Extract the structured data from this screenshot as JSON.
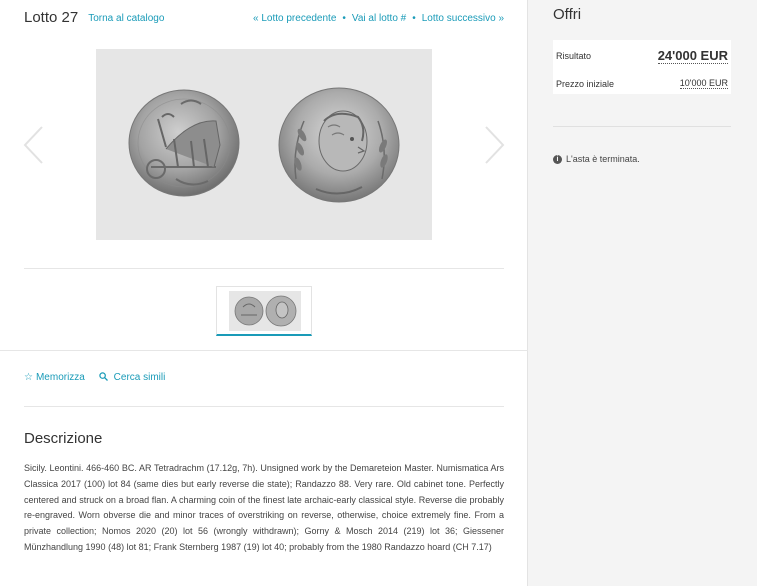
{
  "header": {
    "lot_title": "Lotto 27",
    "back_link": "Torna al catalogo",
    "prev_link": "« Lotto precedente",
    "goto_link": "Vai al lotto #",
    "next_link": "Lotto successivo »",
    "separator": "•"
  },
  "actions": {
    "save_label": "Memorizza",
    "similar_label": "Cerca simili"
  },
  "description": {
    "title": "Descrizione",
    "text": "Sicily. Leontini. 466-460 BC. AR Tetradrachm (17.12g, 7h). Unsigned work by the Demareteion Master. Numismatica Ars Classica 2017 (100) lot 84 (same dies but early reverse die state); Randazzo 88. Very rare. Old cabinet tone. Perfectly centered and struck on a broad flan. A charming coin of the finest late archaic-early classical style. Reverse die probably re-engraved. Worn obverse die and minor traces of overstriking on reverse, otherwise, choice extremely fine. From a private collection; Nomos 2020 (20) lot 56 (wrongly withdrawn); Gorny & Mosch 2014 (219) lot 36; Giessener Münzhandlung 1990 (48) lot 81; Frank Sternberg 1987 (19) lot 40; probably from the 1980 Randazzo hoard (CH 7.17)"
  },
  "offer": {
    "title": "Offri",
    "result_label": "Risultato",
    "result_value": "24'000 EUR",
    "start_label": "Prezzo iniziale",
    "start_value": "10'000 EUR",
    "status": "L'asta è terminata."
  },
  "colors": {
    "accent": "#1a9bb8",
    "panel_bg": "#f4f4f4",
    "image_bg": "#e6e6e6"
  },
  "icons": {
    "star": "star-icon",
    "search": "search-icon",
    "info": "info-icon",
    "prev": "chevron-left-icon",
    "next": "chevron-right-icon"
  }
}
